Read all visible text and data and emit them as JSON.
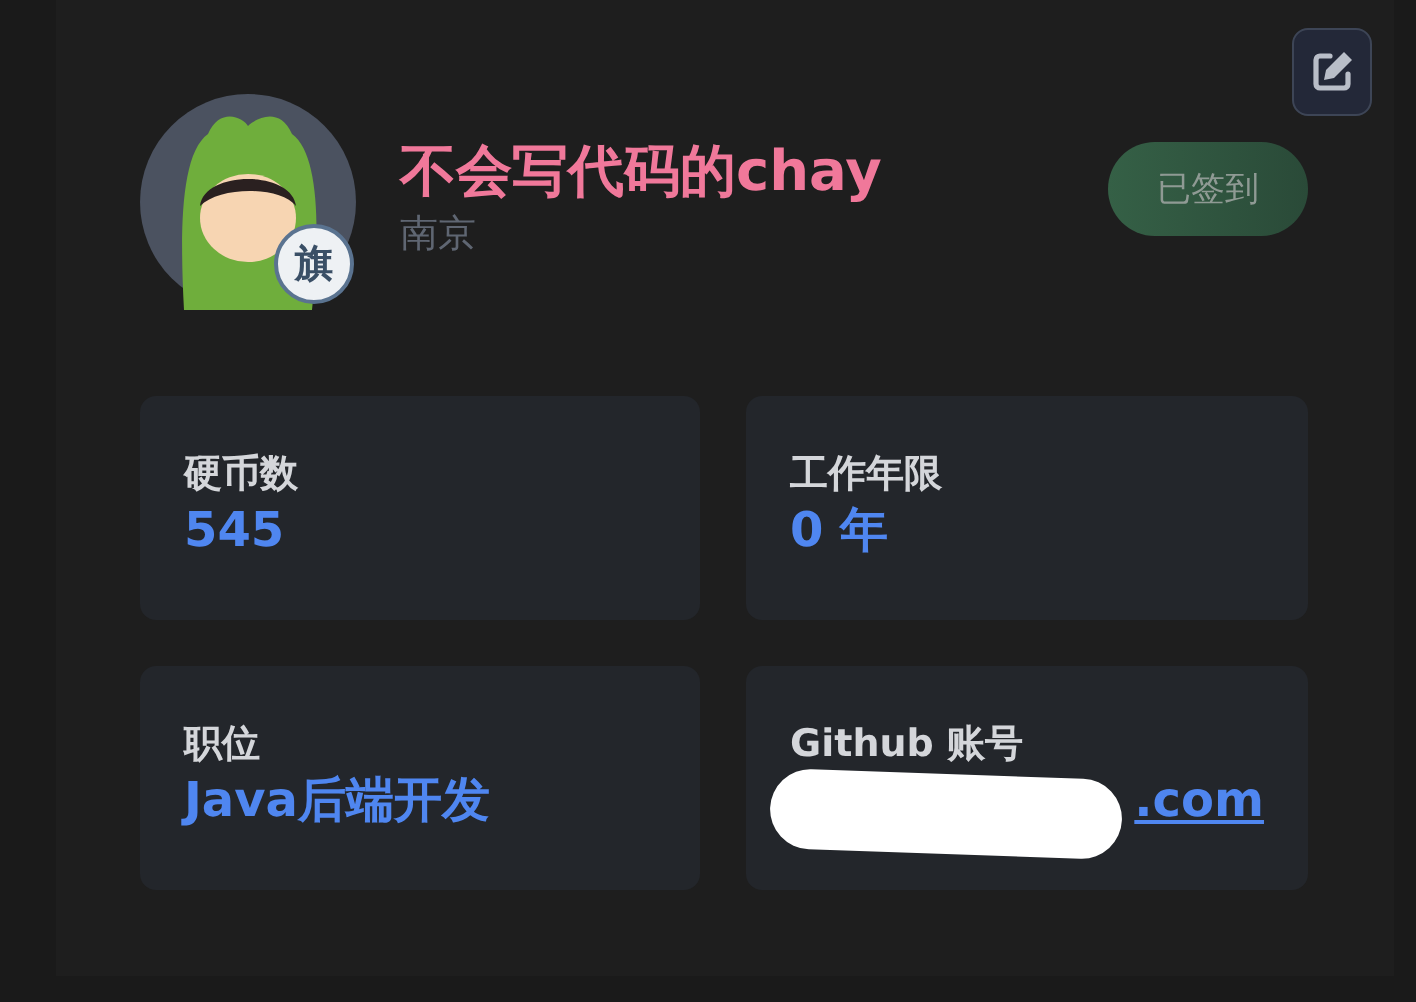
{
  "profile": {
    "name": "不会写代码的chay",
    "location": "南京",
    "badge": "旗",
    "checkin": {
      "label": "已签到",
      "checked": true
    }
  },
  "stats": [
    {
      "label": "硬币数",
      "value": "545",
      "kind": "text"
    },
    {
      "label": "工作年限",
      "value": "0 年",
      "kind": "text"
    },
    {
      "label": "职位",
      "value": "Java后端开发",
      "kind": "text"
    },
    {
      "label": "Github 账号",
      "value": ".com",
      "kind": "link"
    }
  ]
}
